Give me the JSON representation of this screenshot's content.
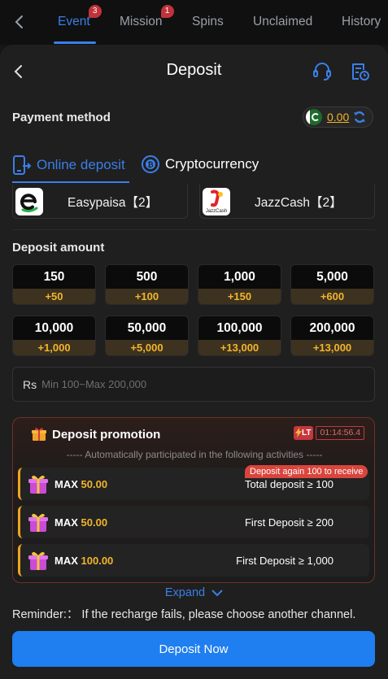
{
  "top_tabs": [
    {
      "label": "Event",
      "badge": "3"
    },
    {
      "label": "Mission",
      "badge": "1"
    },
    {
      "label": "Spins",
      "badge": ""
    },
    {
      "label": "Unclaimed",
      "badge": ""
    },
    {
      "label": "History",
      "badge": ""
    }
  ],
  "header": {
    "title": "Deposit"
  },
  "payment_method": {
    "label": "Payment method",
    "balance": "0.00",
    "tabs": [
      "Online deposit",
      "Cryptocurrency"
    ],
    "channels": [
      {
        "name": "Easypaisa【2】"
      },
      {
        "name": "JazzCash【2】",
        "logo_text": "JazzCash"
      }
    ]
  },
  "deposit_amount": {
    "label": "Deposit amount",
    "options": [
      {
        "value": "150",
        "bonus": "+50"
      },
      {
        "value": "500",
        "bonus": "+100"
      },
      {
        "value": "1,000",
        "bonus": "+150"
      },
      {
        "value": "5,000",
        "bonus": "+600"
      },
      {
        "value": "10,000",
        "bonus": "+1,000"
      },
      {
        "value": "50,000",
        "bonus": "+5,000"
      },
      {
        "value": "100,000",
        "bonus": "+13,000"
      },
      {
        "value": "200,000",
        "bonus": "+13,000"
      }
    ],
    "currency_symbol": "Rs",
    "placeholder": "Min 100~Max 200,000"
  },
  "promotion": {
    "title": "Deposit promotion",
    "lt_label": "LT",
    "timer": "01:14:56.4",
    "subtitle": "----- Automatically participated in the following activities -----",
    "tooltip": "Deposit again 100 to receive",
    "items": [
      {
        "max_label": "MAX",
        "max_value": "50.00",
        "condition": "Total deposit ≥ 100"
      },
      {
        "max_label": "MAX",
        "max_value": "50.00",
        "condition": "First Deposit ≥ 200"
      },
      {
        "max_label": "MAX",
        "max_value": "100.00",
        "condition": "First Deposit ≥ 1,000"
      }
    ]
  },
  "expand_label": "Expand",
  "reminder": "Reminder:：  If the recharge fails, please choose another channel.",
  "cta_label": "Deposit Now",
  "colors": {
    "accent": "#1f7ef0",
    "gold": "#f3b52a",
    "alert": "#c4373f"
  }
}
